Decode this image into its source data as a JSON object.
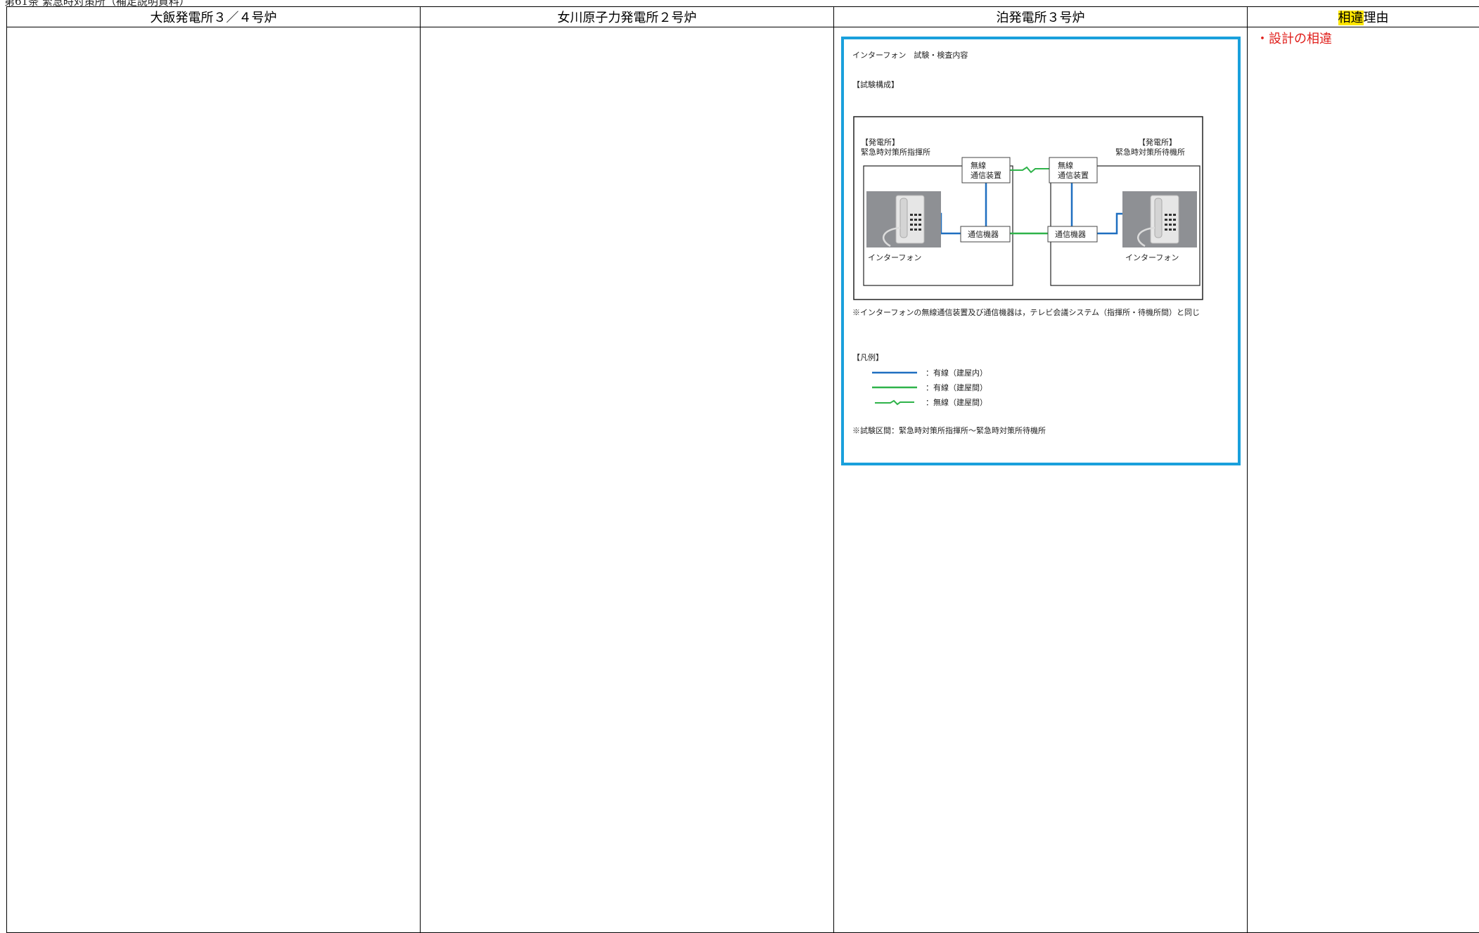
{
  "page_header": "第61条 緊急時対策所（補足説明資料）",
  "columns": [
    "大飯発電所３／４号炉",
    "女川原子力発電所２号炉",
    "泊発電所３号炉"
  ],
  "reason_header": {
    "highlight": "相違",
    "rest": "理由"
  },
  "reason_items": [
    "・設計の相違"
  ],
  "figure": {
    "title": "インターフォン　試験・検査内容",
    "subtitle": "【試験構成】",
    "left_site": "【発電所】",
    "left_place": "緊急時対策所指揮所",
    "right_site": "【発電所】",
    "right_place": "緊急時対策所待機所",
    "wireless_line1": "無線",
    "wireless_line2": "通信装置",
    "comm_device": "通信機器",
    "phone_label": "インターフォン",
    "note": "※インターフォンの無線通信装置及び通信機器は，テレビ会議システム（指揮所・待機所間）と同じ",
    "legend_title": "【凡例】",
    "legend": [
      {
        "label": "：有線（建屋内）",
        "color": "#1f6fc0",
        "kind": "line"
      },
      {
        "label": "：有線（建屋間）",
        "color": "#2fb34a",
        "kind": "line"
      },
      {
        "label": "：無線（建屋間）",
        "color": "#2fb34a",
        "kind": "wireless"
      }
    ],
    "range": "※試験区間：緊急時対策所指揮所〜緊急時対策所待機所"
  }
}
